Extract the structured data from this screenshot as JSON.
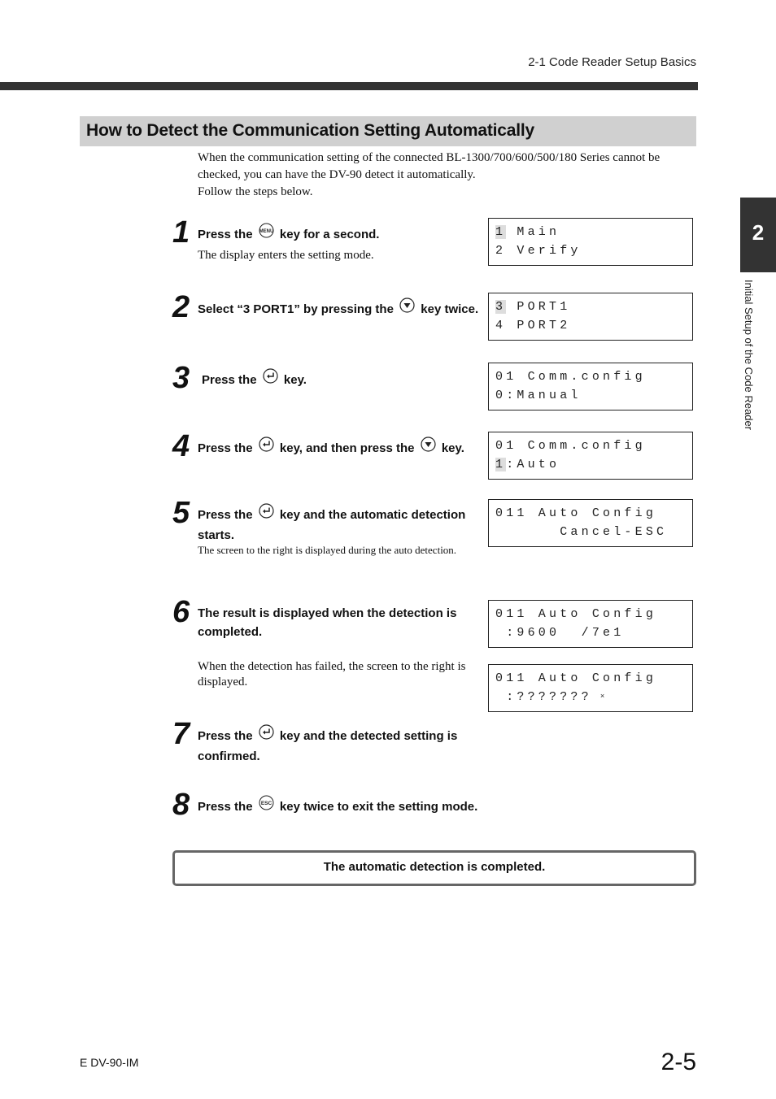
{
  "header": {
    "running_head": "2-1  Code Reader Setup Basics"
  },
  "section": {
    "title": "How to Detect the Communication Setting Automatically",
    "intro": [
      "When the communication setting of the connected BL-1300/700/600/500/180 Series cannot be checked, you can have the DV-90 detect it automatically.",
      "Follow the steps below."
    ]
  },
  "side_tab": {
    "chapter_number": "2",
    "chapter_title": "Initial Setup of the Code Reader"
  },
  "keys": {
    "menu": "menu-key-icon",
    "down": "down-arrow-key-icon",
    "enter": "enter-key-icon",
    "esc": "esc-key-icon"
  },
  "steps": [
    {
      "number": "1",
      "title_pre": "Press the",
      "title_post": "key for a second.",
      "note": "The display enters the setting mode."
    },
    {
      "number": "2",
      "title_pre": "Select “3 PORT1” by pressing the",
      "title_post": "key twice."
    },
    {
      "number": "3",
      "title_pre": "Press the",
      "title_post": "key."
    },
    {
      "number": "4",
      "title_pre": "Press the",
      "title_mid": "key, and then press the",
      "title_post": "key."
    },
    {
      "number": "5",
      "title_pre": "Press the",
      "title_post": "key and the automatic detection starts.",
      "note": "The screen to the right is displayed during the auto detection."
    },
    {
      "number": "6",
      "title": "The result is displayed when the detection is completed.",
      "note": "When the detection has failed, the screen to the right is displayed."
    },
    {
      "number": "7",
      "title_pre": "Press the",
      "title_post": "key and the detected setting is confirmed."
    },
    {
      "number": "8",
      "title_pre": "Press the",
      "title_post": "key twice to exit the setting mode."
    }
  ],
  "lcd_screens": [
    {
      "line1_hl": "1",
      "line1": " Main",
      "line2": "2 Verify"
    },
    {
      "line1_hl": "3",
      "line1": " PORT1",
      "line2": "4 PORT2"
    },
    {
      "line1": "01 Comm.config",
      "line2": "0:Manual"
    },
    {
      "line1": "01 Comm.config",
      "line2_hl": "1",
      "line2": ":Auto"
    },
    {
      "line1": "011 Auto Config",
      "line2": "      Cancel-ESC"
    },
    {
      "line1": "011 Auto Config",
      "line2": " :9600  /7e1"
    },
    {
      "line1": "011 Auto Config",
      "line2": " :???????",
      "line2_mark": "×"
    }
  ],
  "result_box": {
    "text": "The automatic detection is completed."
  },
  "footer": {
    "doc_code": "E DV-90-IM",
    "page_number": "2-5"
  }
}
